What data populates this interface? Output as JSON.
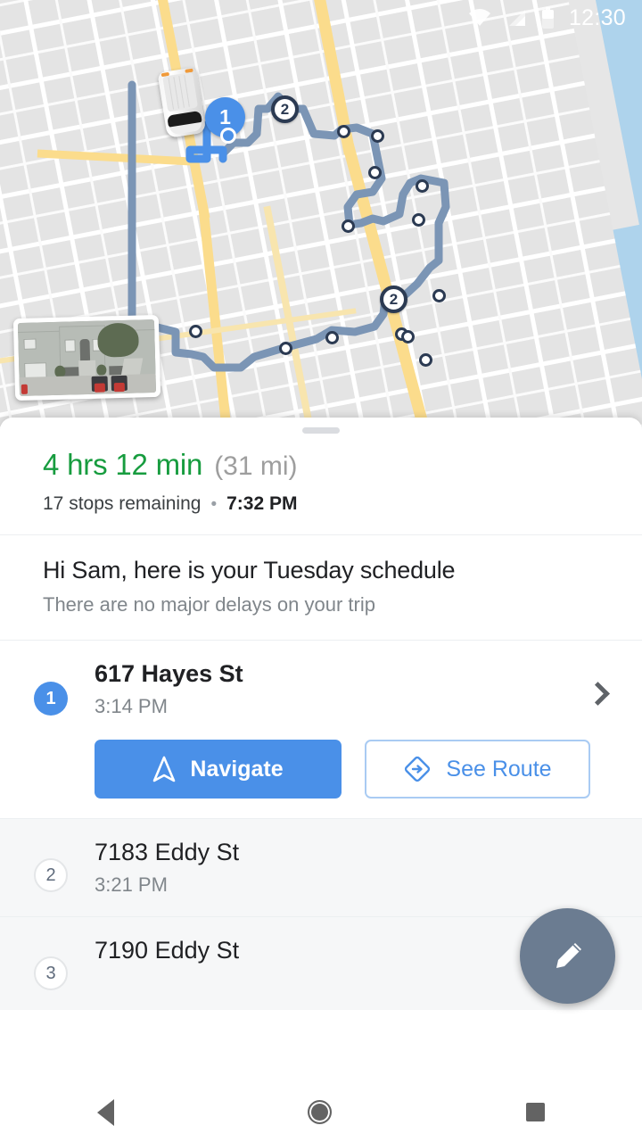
{
  "status_bar": {
    "clock": "12:30",
    "icons": [
      "wifi-icon",
      "cell-signal-icon",
      "battery-icon"
    ]
  },
  "map": {
    "vehicle_icon": "delivery-van-icon",
    "photo_thumbnail": "street-view-photo",
    "markers": [
      {
        "label": "1",
        "style": "active-blue"
      },
      {
        "label": "2",
        "style": "dark-outline"
      },
      {
        "label": "2",
        "style": "dark-outline"
      }
    ],
    "route_color": "#7b95b5",
    "stop_dot_count": 13,
    "water_color": "#aed3ec",
    "park_color": "#d7ecd3",
    "highway_color": "#fbdc8c"
  },
  "sheet": {
    "drag_handle": "drag-handle",
    "summary": {
      "duration": "4 hrs 12 min",
      "distance": "(31 mi)",
      "duration_color": "#179c3f",
      "stops_remaining": "17 stops remaining",
      "separator": "•",
      "arrival_time": "7:32 PM"
    },
    "greeting": {
      "title": "Hi Sam, here is your Tuesday schedule",
      "subtitle": "There are no major delays on your trip"
    },
    "stops": [
      {
        "badge": "1",
        "address": "617 Hayes St",
        "time": "3:14 PM",
        "state": "active",
        "chevron_icon": "chevron-right-icon",
        "actions": {
          "navigate_label": "Navigate",
          "navigate_icon": "navigation-arrow-icon",
          "navigate_color": "#4a90e8",
          "see_route_label": "See Route",
          "see_route_icon": "route-diamond-icon",
          "see_route_color": "#4a90e8"
        }
      },
      {
        "badge": "2",
        "address": "7183 Eddy St",
        "time": "3:21 PM",
        "state": "dim"
      },
      {
        "badge": "3",
        "address": "7190 Eddy St",
        "time": "",
        "state": "dim-clipped"
      }
    ],
    "fab": {
      "icon": "pencil-edit-icon",
      "color": "#6b7c91"
    }
  },
  "nav_bar": {
    "back": "back-icon",
    "home": "home-icon",
    "recents": "recents-icon"
  }
}
